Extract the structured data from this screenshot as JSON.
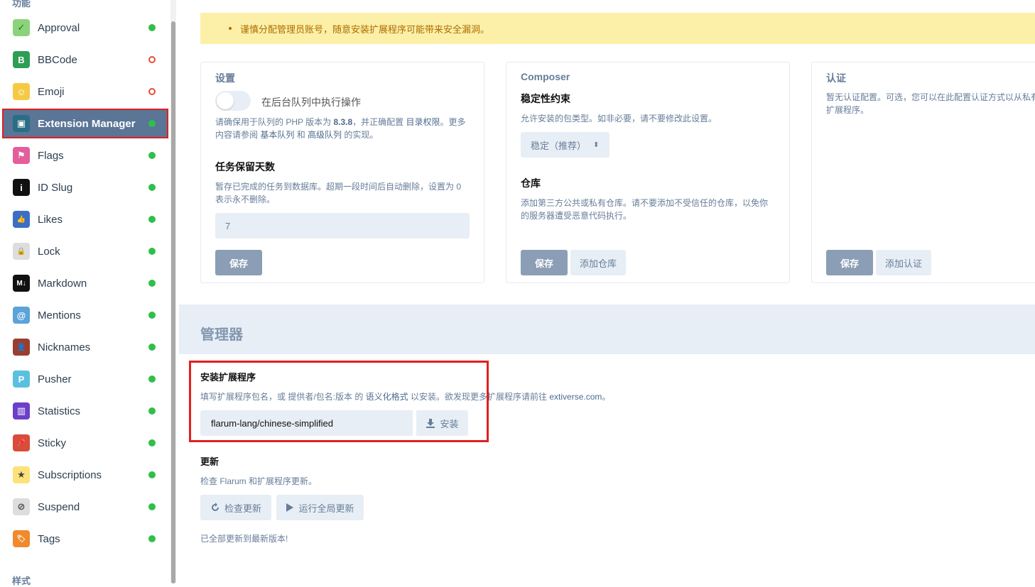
{
  "sidebar": {
    "group_features": "功能",
    "group_themes": "样式",
    "items": [
      {
        "label": "Approval",
        "status": "on",
        "icon": "check-icon",
        "icon_bg": "#8bd37a",
        "glyph": "✓"
      },
      {
        "label": "BBCode",
        "status": "off",
        "icon": "bbcode-icon",
        "icon_bg": "#2d9e54",
        "glyph": "B"
      },
      {
        "label": "Emoji",
        "status": "off",
        "icon": "smile-icon",
        "icon_bg": "#f6c945",
        "glyph": "☺"
      },
      {
        "label": "Extension Manager",
        "status": "on",
        "icon": "box-icon",
        "icon_bg": "#2b6d84",
        "glyph": "▣"
      },
      {
        "label": "Flags",
        "status": "on",
        "icon": "flag-icon",
        "icon_bg": "#e45e9c",
        "glyph": "⚑"
      },
      {
        "label": "ID Slug",
        "status": "on",
        "icon": "info-icon",
        "icon_bg": "#111111",
        "glyph": "i"
      },
      {
        "label": "Likes",
        "status": "on",
        "icon": "thumbs-up-icon",
        "icon_bg": "#3b6fc4",
        "glyph": "👍"
      },
      {
        "label": "Lock",
        "status": "on",
        "icon": "lock-icon",
        "icon_bg": "#dddddd",
        "glyph": "🔒"
      },
      {
        "label": "Markdown",
        "status": "on",
        "icon": "markdown-icon",
        "icon_bg": "#111111",
        "glyph": "M↓"
      },
      {
        "label": "Mentions",
        "status": "on",
        "icon": "at-icon",
        "icon_bg": "#5ba3d9",
        "glyph": "@"
      },
      {
        "label": "Nicknames",
        "status": "on",
        "icon": "user-tag-icon",
        "icon_bg": "#9a3f2f",
        "glyph": "👤"
      },
      {
        "label": "Pusher",
        "status": "on",
        "icon": "pusher-icon",
        "icon_bg": "#5bc0e0",
        "glyph": "P"
      },
      {
        "label": "Statistics",
        "status": "on",
        "icon": "chart-icon",
        "icon_bg": "#6c3fc9",
        "glyph": "▥"
      },
      {
        "label": "Sticky",
        "status": "on",
        "icon": "thumbtack-icon",
        "icon_bg": "#d94c3a",
        "glyph": "📌"
      },
      {
        "label": "Subscriptions",
        "status": "on",
        "icon": "star-icon",
        "icon_bg": "#fde27a",
        "glyph": "★"
      },
      {
        "label": "Suspend",
        "status": "on",
        "icon": "ban-icon",
        "icon_bg": "#dddddd",
        "glyph": "⊘"
      },
      {
        "label": "Tags",
        "status": "on",
        "icon": "tags-icon",
        "icon_bg": "#f08a2c",
        "glyph": "🏷"
      }
    ]
  },
  "alert": {
    "text": "谨慎分配管理员账号，随意安装扩展程序可能带来安全漏洞。"
  },
  "settings_card": {
    "title": "设置",
    "toggle_label": "在后台队列中执行操作",
    "help_part1": "请确保用于队列的 PHP 版本为 ",
    "php_version": "8.3.8",
    "help_part2": "，并正确配置 ",
    "help_link1": "目录权限",
    "help_part3": "。更多",
    "help_line2_a": "内容请参阅 ",
    "help_link2": "基本队列",
    "help_line2_b": " 和 ",
    "help_link3": "高级队列",
    "help_line2_c": " 的实现。",
    "retention_label": "任务保留天数",
    "retention_help_line1": "暂存已完成的任务到数据库。超期一段时间后自动删除，设置为 0",
    "retention_help_line2": "表示永不删除。",
    "retention_value": "7",
    "save_label": "保存"
  },
  "composer_card": {
    "title": "Composer",
    "stability_label": "稳定性约束",
    "stability_help": "允许安装的包类型。如非必要，请不要修改此设置。",
    "stability_value": "稳定（推荐）",
    "repo_label": "仓库",
    "repo_help_line1": "添加第三方公共或私有仓库。请不要添加不受信任的仓库，以免你",
    "repo_help_line2": "的服务器遭受恶意代码执行。",
    "save_label": "保存",
    "add_repo_label": "添加仓库"
  },
  "auth_card": {
    "title": "认证",
    "help_line1": "暂无认证配置。可选，您可以在此配置认证方式以从私有",
    "help_line2": "扩展程序。",
    "save_label": "保存",
    "add_auth_label": "添加认证"
  },
  "manager": {
    "title": "管理器",
    "install_label": "安装扩展程序",
    "install_help_a": "填写扩展程序包名，或 提供者/包名:版本 的 ",
    "install_help_link": "语义化格式",
    "install_help_b": " 以安装。欲发现更多扩展程序请前往 ",
    "install_help_site": "extiverse.com",
    "install_help_c": "。",
    "install_value": "flarum-lang/chinese-simplified",
    "install_button": "安装",
    "update_label": "更新",
    "update_help": "检查 Flarum 和扩展程序更新。",
    "check_updates_button": "检查更新",
    "run_global_update_button": "运行全局更新",
    "status_text": "已全部更新到最新版本!"
  }
}
